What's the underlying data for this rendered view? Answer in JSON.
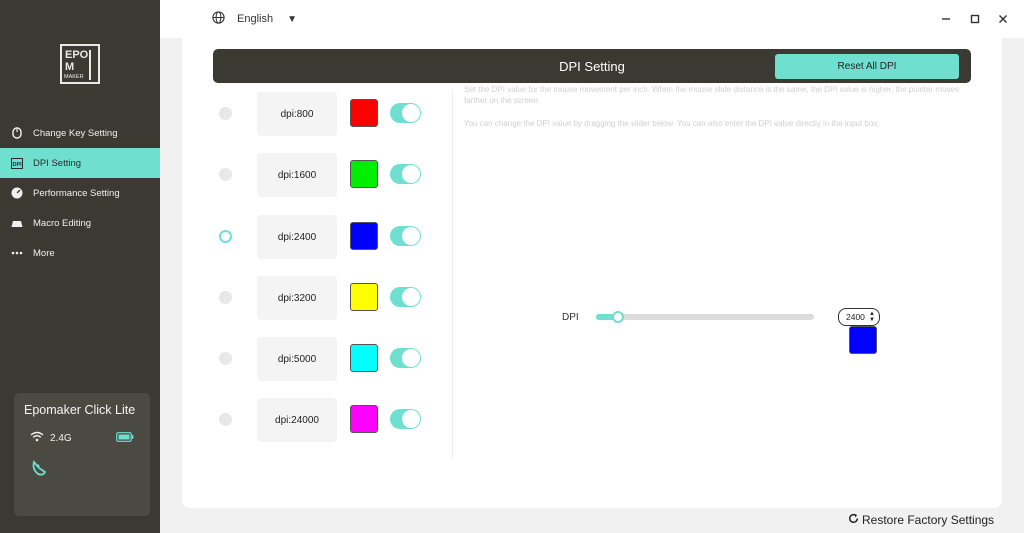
{
  "app": {
    "brand_logo": "EPOMAKER"
  },
  "topbar": {
    "language": "English",
    "language_icon": "globe-icon",
    "minimize_icon": "minimize-icon",
    "maximize_icon": "maximize-icon",
    "close_icon": "close-icon"
  },
  "sidebar": {
    "items": [
      {
        "label": "Change Key Setting",
        "icon": "mouse-icon",
        "active": false
      },
      {
        "label": "DPI Setting",
        "icon": "dpi-icon",
        "active": true
      },
      {
        "label": "Performance Setting",
        "icon": "gauge-icon",
        "active": false
      },
      {
        "label": "Macro Editing",
        "icon": "keyboard-icon",
        "active": false
      },
      {
        "label": "More",
        "icon": "more-icon",
        "active": false
      }
    ],
    "device": {
      "name": "Epomaker Click Lite",
      "connection": "2.4G",
      "battery_icon": "battery-icon"
    }
  },
  "header": {
    "title": "DPI Setting",
    "reset_label": "Reset All DPI"
  },
  "description": {
    "line1": "Set the DPI value for the mouse movement per inch. When the mouse slide distance is the same, the DPI value is higher, the pointer moves farther on the screen.",
    "line2": "You can change the DPI value by dragging the slider below. You can also enter the DPI value directly in the input box."
  },
  "dpi_levels": [
    {
      "label": "dpi:800",
      "color": "#ff0000",
      "enabled": true,
      "selected": false
    },
    {
      "label": "dpi:1600",
      "color": "#00ee00",
      "enabled": true,
      "selected": false
    },
    {
      "label": "dpi:2400",
      "color": "#0000ff",
      "enabled": true,
      "selected": true
    },
    {
      "label": "dpi:3200",
      "color": "#ffff00",
      "enabled": true,
      "selected": false
    },
    {
      "label": "dpi:5000",
      "color": "#00ffff",
      "enabled": true,
      "selected": false
    },
    {
      "label": "dpi:24000",
      "color": "#ff00ff",
      "enabled": true,
      "selected": false
    }
  ],
  "slider": {
    "label": "DPI",
    "value": "2400",
    "fill_fraction": 0.1,
    "color": "#0000ff"
  },
  "footer": {
    "restore_label": "Restore Factory Settings"
  },
  "colors": {
    "accent": "#6fe0d0",
    "sidebar_bg": "#3b3a32"
  }
}
